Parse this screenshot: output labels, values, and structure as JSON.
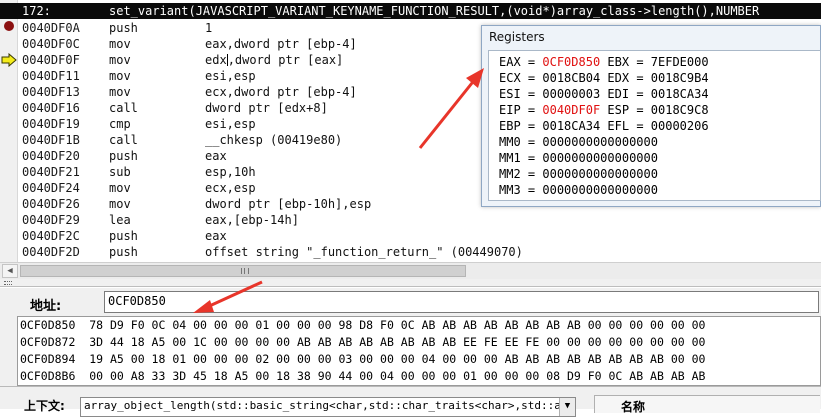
{
  "disassembly": {
    "header": {
      "line": "172:",
      "source": "set_variant(JAVASCRIPT_VARIANT_KEYNAME_FUNCTION_RESULT,(void*)array_class->length(),NUMBER"
    },
    "rows": [
      {
        "addr": "0040DF0A",
        "mnemonic": "push",
        "operand": "1",
        "marker": "breakpoint"
      },
      {
        "addr": "0040DF0C",
        "mnemonic": "mov",
        "operand": "eax,dword ptr [ebp-4]"
      },
      {
        "addr": "0040DF0F",
        "mnemonic": "mov",
        "operand_a": "edx",
        "operand_b": ",dword ptr [eax]",
        "marker": "current"
      },
      {
        "addr": "0040DF11",
        "mnemonic": "mov",
        "operand": "esi,esp"
      },
      {
        "addr": "0040DF13",
        "mnemonic": "mov",
        "operand": "ecx,dword ptr [ebp-4]"
      },
      {
        "addr": "0040DF16",
        "mnemonic": "call",
        "operand": "dword ptr [edx+8]"
      },
      {
        "addr": "0040DF19",
        "mnemonic": "cmp",
        "operand": "esi,esp"
      },
      {
        "addr": "0040DF1B",
        "mnemonic": "call",
        "operand": "__chkesp (00419e80)"
      },
      {
        "addr": "0040DF20",
        "mnemonic": "push",
        "operand": "eax"
      },
      {
        "addr": "0040DF21",
        "mnemonic": "sub",
        "operand": "esp,10h"
      },
      {
        "addr": "0040DF24",
        "mnemonic": "mov",
        "operand": "ecx,esp"
      },
      {
        "addr": "0040DF26",
        "mnemonic": "mov",
        "operand": "dword ptr [ebp-10h],esp"
      },
      {
        "addr": "0040DF29",
        "mnemonic": "lea",
        "operand": "eax,[ebp-14h]"
      },
      {
        "addr": "0040DF2C",
        "mnemonic": "push",
        "operand": "eax"
      },
      {
        "addr": "0040DF2D",
        "mnemonic": "push",
        "operand": "offset string \"_function_return_\" (00449070)"
      }
    ]
  },
  "registers": {
    "title": "Registers",
    "rows": [
      {
        "left_name": "EAX",
        "left_value": "0CF0D850",
        "left_changed": true,
        "right_name": "EBX",
        "right_value": "7EFDE000"
      },
      {
        "left_name": "ECX",
        "left_value": "0018CB04",
        "right_name": "EDX",
        "right_value": "0018C9B4"
      },
      {
        "left_name": "ESI",
        "left_value": "00000003",
        "right_name": "EDI",
        "right_value": "0018CA34"
      },
      {
        "left_name": "EIP",
        "left_value": "0040DF0F",
        "left_changed": true,
        "right_name": "ESP",
        "right_value": "0018C9C8"
      },
      {
        "left_name": "EBP",
        "left_value": "0018CA34",
        "right_name": "EFL",
        "right_value": "00000206"
      },
      {
        "left_name": "MM0",
        "left_value": "0000000000000000"
      },
      {
        "left_name": "MM1",
        "left_value": "0000000000000000"
      },
      {
        "left_name": "MM2",
        "left_value": "0000000000000000"
      },
      {
        "left_name": "MM3",
        "left_value": "0000000000000000"
      }
    ]
  },
  "memory": {
    "address_label": "地址:",
    "address_value": "0CF0D850",
    "rows": [
      "0CF0D850  78 D9 F0 0C 04 00 00 00 01 00 00 00 98 D8 F0 0C AB AB AB AB AB AB AB AB 00 00 00 00 00 00",
      "0CF0D872  3D 44 18 A5 00 1C 00 00 00 00 AB AB AB AB AB AB AB AB EE FE EE FE 00 00 00 00 00 00 00 00",
      "0CF0D894  19 A5 00 18 01 00 00 00 02 00 00 00 03 00 00 00 04 00 00 00 AB AB AB AB AB AB AB AB 00 00",
      "0CF0D8B6  00 00 A8 33 3D 45 18 A5 00 18 38 90 44 00 04 00 00 00 01 00 00 00 08 D9 F0 0C AB AB AB AB"
    ]
  },
  "bottom": {
    "context_label": "上下文:",
    "context_value": "array_object_length(std::basic_string<char,std::char_traits<char>,std::alloc",
    "name_header": "名称"
  },
  "colors": {
    "annotation_arrow": "#e8352a",
    "changed_register": "#e01010",
    "header_bg": "#0a0a0a"
  }
}
